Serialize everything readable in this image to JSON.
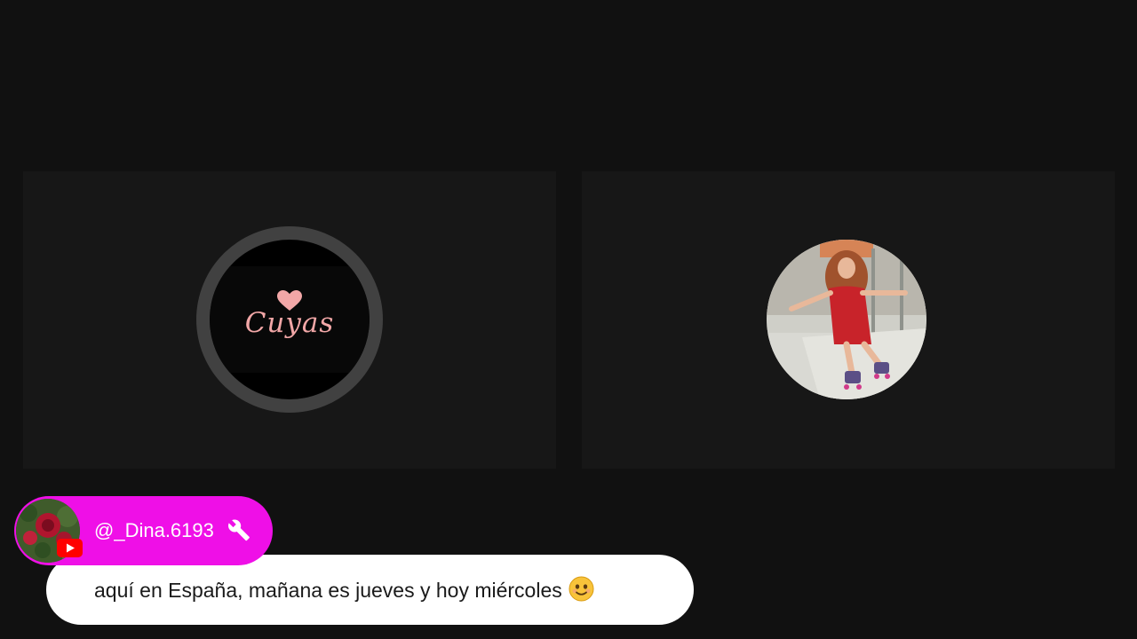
{
  "participants": [
    {
      "name": "cuyas",
      "avatar_type": "logo",
      "logo_text": "Cuyas",
      "logo_icon": "heart-icon",
      "logo_color": "#f2a7a7"
    },
    {
      "name": "skater",
      "avatar_type": "photo",
      "photo_description": "woman with curly red hair in red dress roller skating indoors"
    }
  ],
  "chat": {
    "username": "@_Dina.6193",
    "platform_icon": "youtube-icon",
    "role_icon": "wrench-icon",
    "message": "aquí en España, mañana es jueves y hoy miércoles",
    "emoji_icon": "smiling-face-icon",
    "pill_color": "#ef0fe7"
  }
}
